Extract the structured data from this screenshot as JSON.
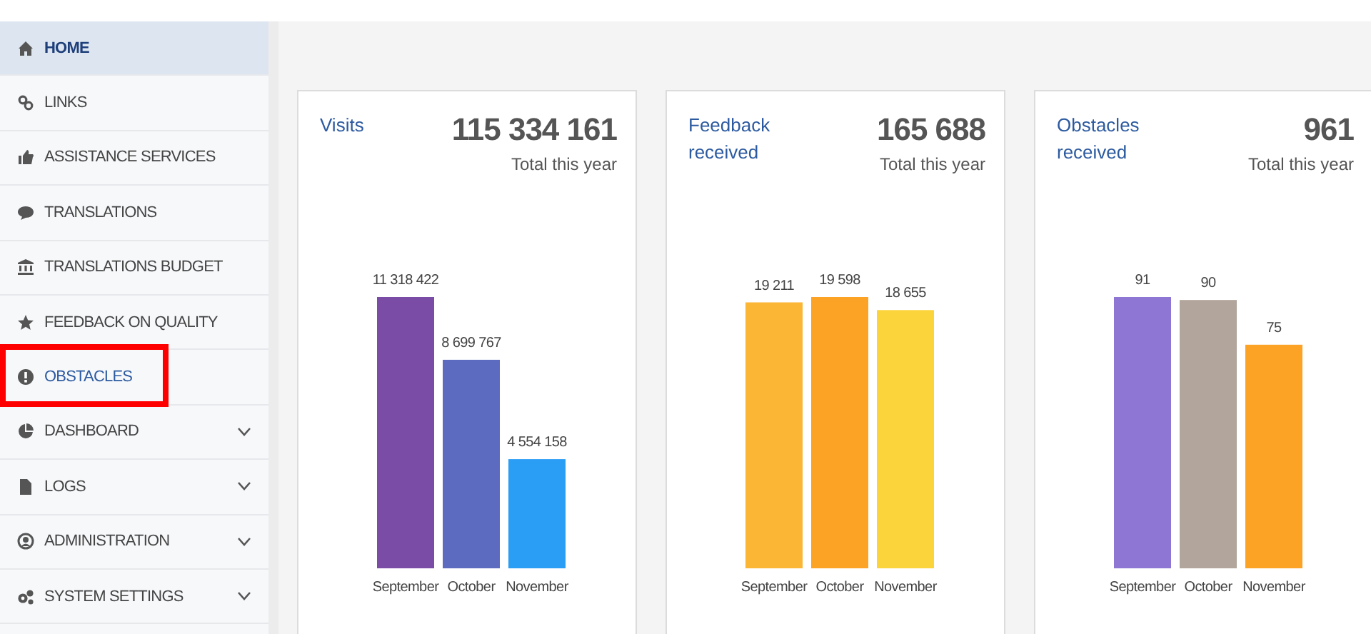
{
  "sidebar": {
    "items": [
      {
        "label": "HOME",
        "selected": true,
        "expandable": false,
        "outlined": false
      },
      {
        "label": "LINKS",
        "selected": false,
        "expandable": false,
        "outlined": false
      },
      {
        "label": "ASSISTANCE SERVICES",
        "selected": false,
        "expandable": false,
        "outlined": false
      },
      {
        "label": "TRANSLATIONS",
        "selected": false,
        "expandable": false,
        "outlined": false
      },
      {
        "label": "TRANSLATIONS BUDGET",
        "selected": false,
        "expandable": false,
        "outlined": false
      },
      {
        "label": "FEEDBACK ON QUALITY",
        "selected": false,
        "expandable": false,
        "outlined": false
      },
      {
        "label": "OBSTACLES",
        "selected": false,
        "expandable": false,
        "outlined": true
      },
      {
        "label": "DASHBOARD",
        "selected": false,
        "expandable": true,
        "outlined": false
      },
      {
        "label": "LOGS",
        "selected": false,
        "expandable": true,
        "outlined": false
      },
      {
        "label": "ADMINISTRATION",
        "selected": false,
        "expandable": true,
        "outlined": false
      },
      {
        "label": "SYSTEM SETTINGS",
        "selected": false,
        "expandable": true,
        "outlined": false
      }
    ]
  },
  "cards": [
    {
      "title": "Visits",
      "total": "115 334 161",
      "total_caption": "Total this year",
      "chart_data": {
        "type": "bar",
        "categories": [
          "September",
          "October",
          "November"
        ],
        "values": [
          11318422,
          8699767,
          4554158
        ],
        "value_labels": [
          "11 318 422",
          "8 699 767",
          "4 554 158"
        ],
        "colors": [
          "#7b4ca5",
          "#5c6bc0",
          "#2a9df4"
        ],
        "data_labels": true
      }
    },
    {
      "title": "Feedback received",
      "total": "165 688",
      "total_caption": "Total this year",
      "chart_data": {
        "type": "bar",
        "categories": [
          "September",
          "October",
          "November"
        ],
        "values": [
          19211,
          19598,
          18655
        ],
        "value_labels": [
          "19 211",
          "19 598",
          "18 655"
        ],
        "colors": [
          "#fbb635",
          "#fca326",
          "#fbd43c"
        ],
        "data_labels": true
      }
    },
    {
      "title": "Obstacles received",
      "total": "961",
      "total_caption": "Total this year",
      "chart_data": {
        "type": "bar",
        "categories": [
          "September",
          "October",
          "November"
        ],
        "values": [
          91,
          90,
          75
        ],
        "value_labels": [
          "91",
          "90",
          "75"
        ],
        "colors": [
          "#8e76d4",
          "#b2a59b",
          "#fca326"
        ],
        "data_labels": true
      }
    }
  ]
}
